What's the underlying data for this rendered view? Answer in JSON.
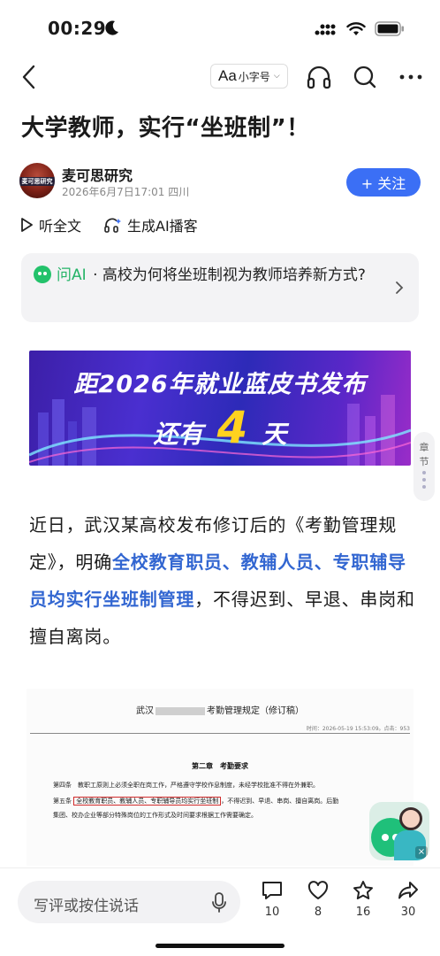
{
  "status_bar": {
    "time": "00:29"
  },
  "nav": {
    "font_aa": "Aa",
    "font_size_label": "小字号"
  },
  "article": {
    "title": "大学教师，实行“坐班制”！",
    "author": {
      "name": "麦可思研究",
      "meta": "2026年6月7日17:01 四川",
      "avatar_text": "麦可思研究"
    },
    "follow_label": "+ 关注",
    "listen_label": "听全文",
    "podcast_label": "生成AI播客",
    "ask_ai": {
      "brand": "问AI",
      "separator": "·",
      "question": "高校为何将坐班制视为教师培养新方式?"
    },
    "banner": {
      "title": "距2026年就业蓝皮书发布",
      "prefix": "还有",
      "number": "4",
      "suffix": "天"
    },
    "body": {
      "part1": "近日，武汉某高校发布修订后的《考勤管理规定》，明确",
      "highlight": "全校教育职员、教辅人员、专职辅导员均实行坐班制管理",
      "part2": "，不得迟到、早退、串岗和擅自离岗。"
    },
    "doc_image": {
      "title_prefix": "武汉",
      "title_suffix": "考勤管理规定（修订稿）",
      "time": "时间：2026-05-19 15:53:09。点击：953",
      "chapter": "第二章　考勤要求",
      "art4": "第四条　教职工原则上必须全职在岗工作，严格遵守学校作息制度，未经学校批准不得在外兼职。",
      "art5_prefix": "第五条",
      "art5_boxed": "全校教育职员、教辅人员、专职辅导员均实行坐班制",
      "art5_suffix": "，不得迟到、早退、串岗、擅自离岗。后勤",
      "art5_line2": "集团、校办企业等部分特殊岗位的工作形式及时间要求根据工作需要确定。"
    }
  },
  "side_tab": {
    "label_1": "章",
    "label_2": "节"
  },
  "assistant": {
    "close": "×"
  },
  "bottom_bar": {
    "comment_placeholder": "写评或按住说话",
    "comments": "10",
    "likes": "8",
    "favorites": "16",
    "shares": "30"
  },
  "colors": {
    "accent": "#3b6ff5",
    "highlight": "#3266d1",
    "ai_green": "#23b366"
  }
}
